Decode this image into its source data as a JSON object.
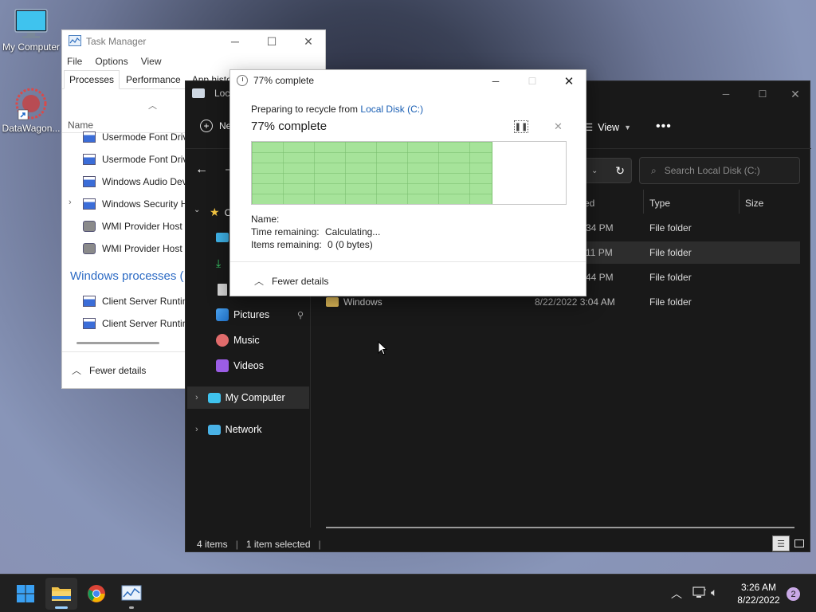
{
  "desktop": {
    "icons": [
      {
        "label": "My Computer"
      },
      {
        "label": "DataWagon..."
      }
    ]
  },
  "task_manager": {
    "title": "Task Manager",
    "menu": [
      "File",
      "Options",
      "View"
    ],
    "tabs": [
      "Processes",
      "Performance",
      "App histor"
    ],
    "column_name": "Name",
    "rows": [
      {
        "label": "Usermode Font Drive",
        "expandable": false
      },
      {
        "label": "Usermode Font Drive",
        "expandable": false
      },
      {
        "label": "Windows Audio Dev",
        "expandable": false
      },
      {
        "label": "Windows Security H",
        "expandable": true
      },
      {
        "label": "WMI Provider Host",
        "expandable": false
      },
      {
        "label": "WMI Provider Host",
        "expandable": false
      }
    ],
    "group_heading": "Windows processes (",
    "group_rows": [
      {
        "label": "Client Server Runtim"
      },
      {
        "label": "Client Server Runtim"
      }
    ],
    "fewer_details": "Fewer details"
  },
  "explorer": {
    "title": "Local",
    "new_label": "Ne",
    "view_label": "View",
    "search_placeholder": "Search Local Disk (C:)",
    "columns": {
      "modified": "ed",
      "type": "Type",
      "size": "Size"
    },
    "sidebar": {
      "quick_access": "C",
      "pictures": "Pictures",
      "music": "Music",
      "videos": "Videos",
      "my_computer": "My Computer",
      "network": "Network"
    },
    "files": [
      {
        "name": "",
        "modified": "34 PM",
        "type": "File folder"
      },
      {
        "name": "",
        "modified": "11 PM",
        "type": "File folder"
      },
      {
        "name": "",
        "modified": "44 PM",
        "type": "File folder"
      },
      {
        "name": "Windows",
        "modified": "8/22/2022 3:04 AM",
        "type": "File folder"
      }
    ],
    "status": {
      "items": "4 items",
      "selected": "1 item selected"
    }
  },
  "progress_dialog": {
    "title": "77% complete",
    "preparing_prefix": "Preparing to recycle from ",
    "source_link": "Local Disk (C:)",
    "percent_text": "77% complete",
    "progress_fraction": 0.77,
    "name_label": "Name:",
    "time_remaining_label": "Time remaining:",
    "time_remaining_value": "Calculating...",
    "items_remaining_label": "Items remaining:",
    "items_remaining_value": "0 (0 bytes)",
    "fewer_details": "Fewer details",
    "bar_color": "#a6e39a"
  },
  "taskbar": {
    "time": "3:26 AM",
    "date": "8/22/2022",
    "notification_count": "2"
  },
  "colors": {
    "accent": "#0067c0",
    "link": "#1a5fb4",
    "explorer_bg": "#191919"
  }
}
